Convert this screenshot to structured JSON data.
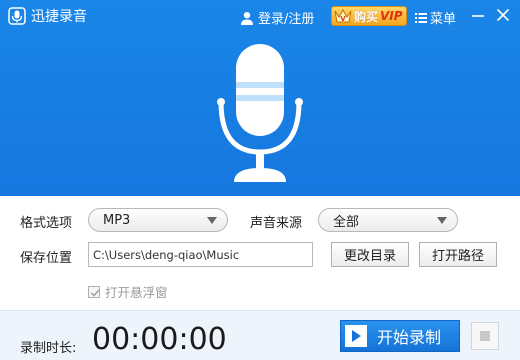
{
  "titlebar": {
    "app_title": "迅捷录音",
    "login_label": "登录/注册",
    "vip_buy": "购买",
    "vip_text": "VIP",
    "menu_label": "菜单",
    "icons": {
      "app": "app-logo-icon",
      "user": "user-icon",
      "crown": "crown-icon",
      "menu": "menu-icon",
      "minimize": "minimize-icon",
      "close": "close-icon",
      "mic": "microphone-icon"
    }
  },
  "settings": {
    "format_label": "格式选项",
    "format_value": "MP3",
    "source_label": "声音来源",
    "source_value": "全部",
    "save_label": "保存位置",
    "save_path": "C:\\Users\\deng-qiao\\Music",
    "change_dir_button": "更改目录",
    "open_path_button": "打开路径",
    "float_window_label": "打开悬浮窗",
    "float_window_checked": true
  },
  "footer": {
    "duration_label": "录制时长:",
    "timer": "00:00:00",
    "start_button": "开始录制"
  },
  "colors": {
    "header_blue": "#1a86e8",
    "vip_gold": "#f3a51c",
    "footer_bg": "#eef4fb",
    "button_blue": "#1573d8"
  }
}
